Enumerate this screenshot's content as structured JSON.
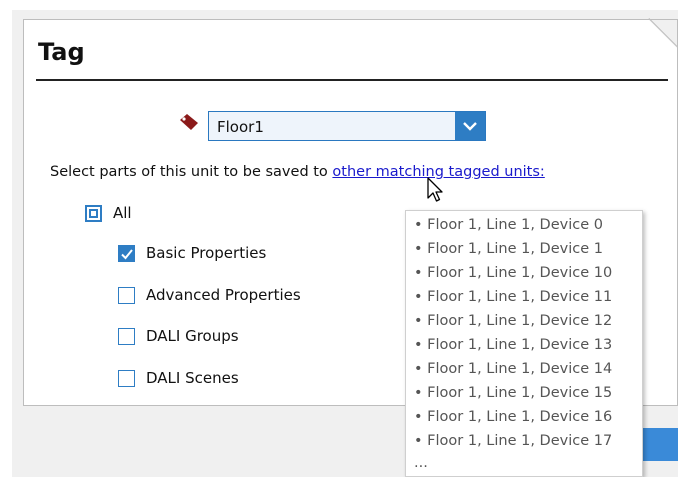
{
  "panel": {
    "title": "Tag"
  },
  "tag_select": {
    "icon": "tag-icon",
    "value": "Floor1",
    "accent": "#2e7dc4"
  },
  "instruction": {
    "prefix": "Select parts of this unit to be saved to ",
    "link": "other matching tagged units:"
  },
  "checkboxes": {
    "all": {
      "label": "All",
      "state": "indeterminate"
    },
    "items": [
      {
        "label": "Basic Properties",
        "checked": true
      },
      {
        "label": "Advanced Properties",
        "checked": false
      },
      {
        "label": "DALI Groups",
        "checked": false
      },
      {
        "label": "DALI Scenes",
        "checked": false
      }
    ]
  },
  "tooltip": {
    "items": [
      "• Floor 1, Line 1, Device 0",
      "• Floor 1, Line 1, Device 1",
      "• Floor 1, Line 1, Device 10",
      "• Floor 1, Line 1, Device 11",
      "• Floor 1, Line 1, Device 12",
      "• Floor 1, Line 1, Device 13",
      "• Floor 1, Line 1, Device 14",
      "• Floor 1, Line 1, Device 15",
      "• Floor 1, Line 1, Device 16",
      "• Floor 1, Line 1, Device 17"
    ],
    "more": "..."
  }
}
